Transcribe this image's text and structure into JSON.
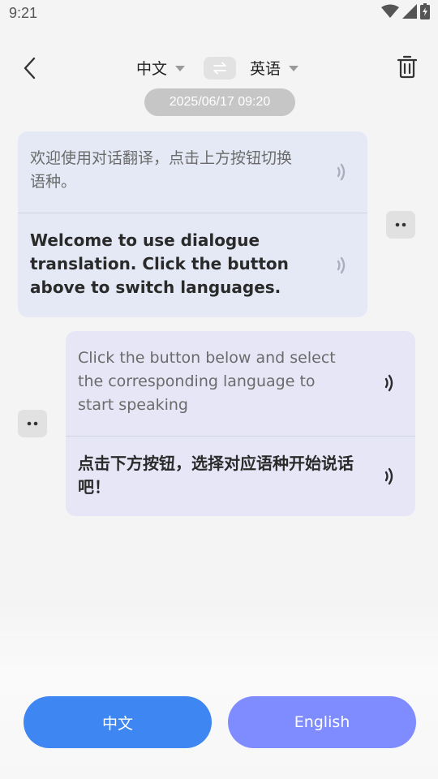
{
  "status_bar": {
    "time": "9:21",
    "icons": [
      "wifi-icon",
      "cell-signal-icon",
      "battery-icon"
    ]
  },
  "header": {
    "source_language": "中文",
    "target_language": "英语",
    "icons": [
      "back-arrow-icon",
      "swap-icon",
      "trash-icon"
    ]
  },
  "conversation": {
    "timestamp": "2025/06/17 09:20",
    "messages": [
      {
        "side": "left",
        "source_text": "欢迎使用对话翻译，点击上方按钮切换语种。",
        "translated_text": "Welcome to use dialogue translation. Click the button above to switch languages."
      },
      {
        "side": "right",
        "source_text": "Click the button below and select the corresponding language to start speaking",
        "translated_text": "点击下方按钮，选择对应语种开始说话吧！"
      }
    ]
  },
  "bottom": {
    "chinese_button": "中文",
    "english_button": "English"
  },
  "colors": {
    "chinese_button": "#3e86f1",
    "english_button": "#7f8cff",
    "left_card": "#e4e9f5",
    "right_card": "#e6e6f7"
  }
}
